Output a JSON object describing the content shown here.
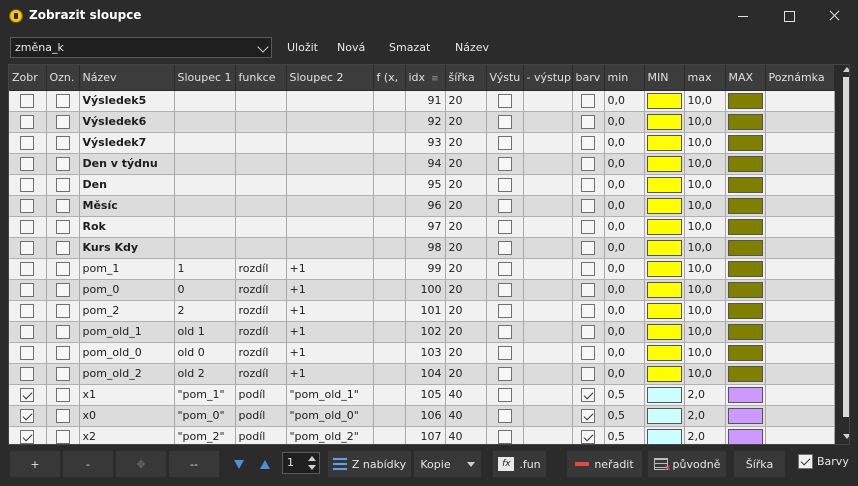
{
  "window": {
    "title": "Zobrazit sloupce",
    "icon": "app-icon"
  },
  "toolbar": {
    "profile": "změna_k",
    "save": "Uložit",
    "new": "Nová",
    "delete": "Smazat",
    "name": "Název"
  },
  "columns": [
    "Zobr",
    "Ozn.",
    "Název",
    "Sloupec 1",
    "funkce",
    "Sloupec 2",
    "f (x,",
    "idx",
    "šířka",
    "Výstu",
    "- výstup",
    "barv",
    "min",
    "MIN",
    "max",
    "MAX",
    "Poznámka"
  ],
  "colors": {
    "yellow": "#ffff00",
    "olive": "#808000",
    "light_cyan": "#ccffff",
    "lilac": "#cc99ff"
  },
  "rows": [
    {
      "zobr": false,
      "ozn": false,
      "nazev": "Výsledek5",
      "bold": true,
      "s1": "",
      "fn": "",
      "s2": "",
      "fx": "",
      "idx": "91",
      "sirka": "20",
      "vystup": false,
      "barva": false,
      "min": "0,0",
      "minc": "#ffff00",
      "max": "10,0",
      "maxc": "#808000"
    },
    {
      "zobr": false,
      "ozn": false,
      "nazev": "Výsledek6",
      "bold": true,
      "s1": "",
      "fn": "",
      "s2": "",
      "fx": "",
      "idx": "92",
      "sirka": "20",
      "vystup": false,
      "barva": false,
      "min": "0,0",
      "minc": "#ffff00",
      "max": "10,0",
      "maxc": "#808000"
    },
    {
      "zobr": false,
      "ozn": false,
      "nazev": "Výsledek7",
      "bold": true,
      "s1": "",
      "fn": "",
      "s2": "",
      "fx": "",
      "idx": "93",
      "sirka": "20",
      "vystup": false,
      "barva": false,
      "min": "0,0",
      "minc": "#ffff00",
      "max": "10,0",
      "maxc": "#808000"
    },
    {
      "zobr": false,
      "ozn": false,
      "nazev": "Den v týdnu",
      "bold": true,
      "s1": "",
      "fn": "",
      "s2": "",
      "fx": "",
      "idx": "94",
      "sirka": "20",
      "vystup": false,
      "barva": false,
      "min": "0,0",
      "minc": "#ffff00",
      "max": "10,0",
      "maxc": "#808000"
    },
    {
      "zobr": false,
      "ozn": false,
      "nazev": "Den",
      "bold": true,
      "s1": "",
      "fn": "",
      "s2": "",
      "fx": "",
      "idx": "95",
      "sirka": "20",
      "vystup": false,
      "barva": false,
      "min": "0,0",
      "minc": "#ffff00",
      "max": "10,0",
      "maxc": "#808000"
    },
    {
      "zobr": false,
      "ozn": false,
      "nazev": "Měsíc",
      "bold": true,
      "s1": "",
      "fn": "",
      "s2": "",
      "fx": "",
      "idx": "96",
      "sirka": "20",
      "vystup": false,
      "barva": false,
      "min": "0,0",
      "minc": "#ffff00",
      "max": "10,0",
      "maxc": "#808000"
    },
    {
      "zobr": false,
      "ozn": false,
      "nazev": "Rok",
      "bold": true,
      "s1": "",
      "fn": "",
      "s2": "",
      "fx": "",
      "idx": "97",
      "sirka": "20",
      "vystup": false,
      "barva": false,
      "min": "0,0",
      "minc": "#ffff00",
      "max": "10,0",
      "maxc": "#808000"
    },
    {
      "zobr": false,
      "ozn": false,
      "nazev": "Kurs Kdy",
      "bold": true,
      "s1": "",
      "fn": "",
      "s2": "",
      "fx": "",
      "idx": "98",
      "sirka": "20",
      "vystup": false,
      "barva": false,
      "min": "0,0",
      "minc": "#ffff00",
      "max": "10,0",
      "maxc": "#808000"
    },
    {
      "zobr": false,
      "ozn": false,
      "nazev": "pom_1",
      "bold": false,
      "s1": "1",
      "fn": "rozdíl",
      "s2": "+1",
      "fx": "",
      "idx": "99",
      "sirka": "20",
      "vystup": false,
      "barva": false,
      "min": "0,0",
      "minc": "#ffff00",
      "max": "10,0",
      "maxc": "#808000"
    },
    {
      "zobr": false,
      "ozn": false,
      "nazev": "pom_0",
      "bold": false,
      "s1": "0",
      "fn": "rozdíl",
      "s2": "+1",
      "fx": "",
      "idx": "100",
      "sirka": "20",
      "vystup": false,
      "barva": false,
      "min": "0,0",
      "minc": "#ffff00",
      "max": "10,0",
      "maxc": "#808000"
    },
    {
      "zobr": false,
      "ozn": false,
      "nazev": "pom_2",
      "bold": false,
      "s1": "2",
      "fn": "rozdíl",
      "s2": "+1",
      "fx": "",
      "idx": "101",
      "sirka": "20",
      "vystup": false,
      "barva": false,
      "min": "0,0",
      "minc": "#ffff00",
      "max": "10,0",
      "maxc": "#808000"
    },
    {
      "zobr": false,
      "ozn": false,
      "nazev": "pom_old_1",
      "bold": false,
      "s1": "old 1",
      "fn": "rozdíl",
      "s2": "+1",
      "fx": "",
      "idx": "102",
      "sirka": "20",
      "vystup": false,
      "barva": false,
      "min": "0,0",
      "minc": "#ffff00",
      "max": "10,0",
      "maxc": "#808000"
    },
    {
      "zobr": false,
      "ozn": false,
      "nazev": "pom_old_0",
      "bold": false,
      "s1": "old 0",
      "fn": "rozdíl",
      "s2": "+1",
      "fx": "",
      "idx": "103",
      "sirka": "20",
      "vystup": false,
      "barva": false,
      "min": "0,0",
      "minc": "#ffff00",
      "max": "10,0",
      "maxc": "#808000"
    },
    {
      "zobr": false,
      "ozn": false,
      "nazev": "pom_old_2",
      "bold": false,
      "s1": "old 2",
      "fn": "rozdíl",
      "s2": "+1",
      "fx": "",
      "idx": "104",
      "sirka": "20",
      "vystup": false,
      "barva": false,
      "min": "0,0",
      "minc": "#ffff00",
      "max": "10,0",
      "maxc": "#808000"
    },
    {
      "zobr": true,
      "ozn": false,
      "nazev": "x1",
      "bold": false,
      "s1": "\"pom_1\"",
      "fn": "podíl",
      "s2": "\"pom_old_1\"",
      "fx": "",
      "idx": "105",
      "sirka": "40",
      "vystup": false,
      "barva": true,
      "min": "0,5",
      "minc": "#ccffff",
      "max": "2,0",
      "maxc": "#cc99ff"
    },
    {
      "zobr": true,
      "ozn": false,
      "nazev": "x0",
      "bold": false,
      "s1": "\"pom_0\"",
      "fn": "podíl",
      "s2": "\"pom_old_0\"",
      "fx": "",
      "idx": "106",
      "sirka": "40",
      "vystup": false,
      "barva": true,
      "min": "0,5",
      "minc": "#ccffff",
      "max": "2,0",
      "maxc": "#cc99ff"
    },
    {
      "zobr": true,
      "ozn": false,
      "nazev": "x2",
      "bold": false,
      "s1": "\"pom_2\"",
      "fn": "podíl",
      "s2": "\"pom_old_2\"",
      "fx": "",
      "idx": "107",
      "sirka": "40",
      "vystup": false,
      "barva": true,
      "min": "0,5",
      "minc": "#ccffff",
      "max": "2,0",
      "maxc": "#cc99ff"
    }
  ],
  "bottom": {
    "add": "+",
    "remove": "-",
    "dash": "--",
    "spin_value": "1",
    "from_menu": "Z nabídky",
    "copy": "Kopie",
    "fun": ".fun",
    "unsort": "neřadit",
    "original": "původně",
    "width": "Šířka",
    "colors": "Barvy",
    "colors_checked": true
  }
}
